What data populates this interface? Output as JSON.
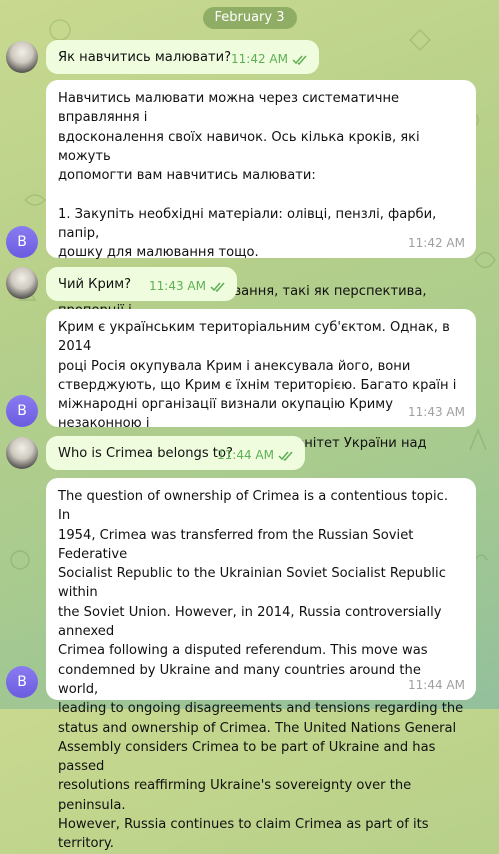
{
  "date_label": "February 3",
  "messages": [
    {
      "role": "user",
      "text": "Як навчитись малювати?",
      "time": "11:42 AM"
    },
    {
      "role": "bot",
      "avatar_letter": "B",
      "text": "Навчитись малювати можна через систематичне вправляння і\nвдосконалення своїх навичок. Ось кілька кроків, які можуть\nдопомогти вам навчитись малювати:\n\n1. Закупіть необхідні матеріали: олівці, пензлі, фарби, папір,\nдошку для малювання тощо.\n\n2. Вивчайте основи малювання, такі як перспектива, пропорції і\nсвітло тіні. Існують безліч посібників, онлайн",
      "time": "11:42 AM"
    },
    {
      "role": "user",
      "text": "Чий Крим?",
      "time": "11:43 AM"
    },
    {
      "role": "bot",
      "avatar_letter": "B",
      "text": "Крим є українським територіальним суб'єктом. Однак, в 2014\nроці Росія окупувала Крим і анексувала його, вони\nстверджують, що Крим є їхнім територією. Багато країн і\nміжнародні організації визнали окупацію Криму незаконною і\nпродовжують підтримувати суверенітет України над Кримом.",
      "time": "11:43 AM"
    },
    {
      "role": "user",
      "text": "Who is Crimea belongs to?",
      "time": "11:44 AM"
    },
    {
      "role": "bot",
      "avatar_letter": "B",
      "text": "The question of ownership of Crimea is a contentious topic. In\n1954, Crimea was transferred from the Russian Soviet Federative\nSocialist Republic to the Ukrainian Soviet Socialist Republic within\nthe Soviet Union. However, in 2014, Russia controversially annexed\nCrimea following a disputed referendum. This move was\ncondemned by Ukraine and many countries around the world,\nleading to ongoing disagreements and tensions regarding the\nstatus and ownership of Crimea. The United Nations General\nAssembly considers Crimea to be part of Ukraine and has passed\nresolutions reaffirming Ukraine's sovereignty over the peninsula.\nHowever, Russia continues to claim Crimea as part of its territory.",
      "time": "11:44 AM"
    }
  ],
  "colors": {
    "outgoing_bubble": "#effdde",
    "incoming_bubble": "#ffffff",
    "read_check": "#5eaf56",
    "bot_avatar": "#7a6cec",
    "date_pill": "#668c46"
  },
  "icons": {
    "user_avatar": "user-photo-avatar",
    "read_receipt": "double-check-icon"
  }
}
